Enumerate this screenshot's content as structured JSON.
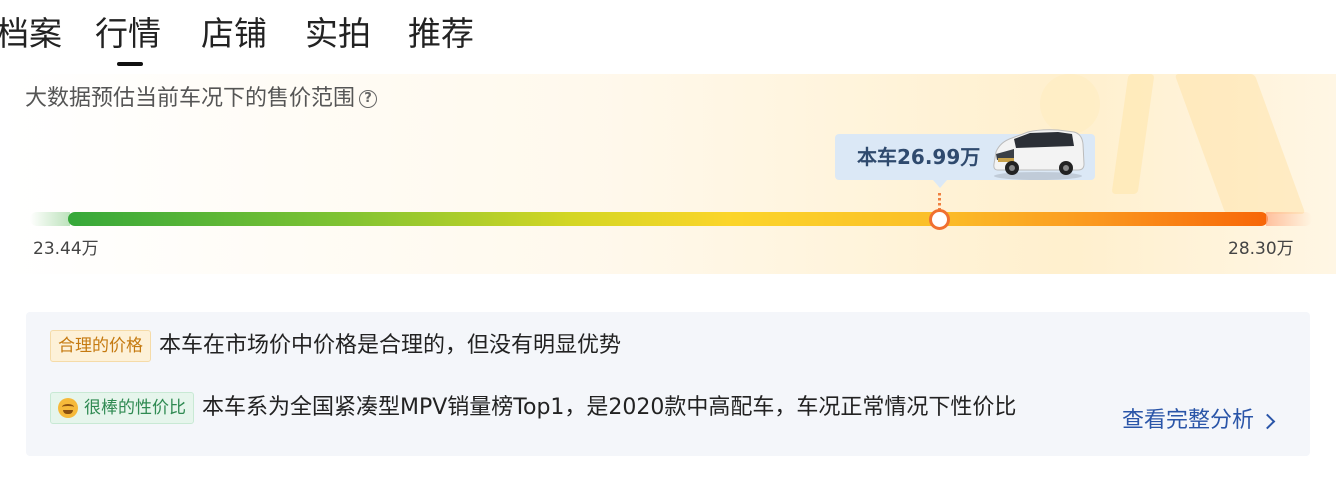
{
  "tabs": [
    {
      "label": "档案"
    },
    {
      "label": "行情"
    },
    {
      "label": "店铺"
    },
    {
      "label": "实拍"
    },
    {
      "label": "推荐"
    }
  ],
  "active_tab": "行情",
  "price_range": {
    "subtitle": "大数据预估当前车况下的售价范围",
    "help_icon": "question-circle-icon",
    "current_label": "本车26.99万",
    "current_price": 26.99,
    "min_label": "23.44万",
    "min_price": 23.44,
    "max_label": "28.30万",
    "max_price": 28.3,
    "bar_colors": [
      "#36a83a",
      "#d4d624",
      "#fbd52a",
      "#f76608"
    ],
    "marker_color": "#f07030"
  },
  "analysis": {
    "rows": [
      {
        "tag": "合理的价格",
        "text": "本车在市场价中价格是合理的，但没有明显优势"
      },
      {
        "tag": "很棒的性价比",
        "tag_icon": "smile-emoji-icon",
        "text": "本车系为全国紧凑型MPV销量榜Top1，是2020款中高配车，车况正常情况下性价比"
      }
    ],
    "more_link": "查看完整分析"
  }
}
